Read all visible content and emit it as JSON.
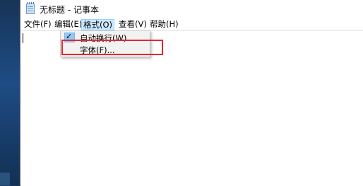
{
  "window": {
    "title": "无标题 - 记事本"
  },
  "menubar": {
    "items": [
      {
        "label": "文件(F)"
      },
      {
        "label": "编辑(E)"
      },
      {
        "label": "格式(O)"
      },
      {
        "label": "查看(V)"
      },
      {
        "label": "帮助(H)"
      }
    ]
  },
  "format_menu": {
    "word_wrap": {
      "label": "自动换行(W)",
      "checked": true
    },
    "font": {
      "label": "字体(F)..."
    }
  },
  "colors": {
    "highlight": "#e8262b",
    "menu_active": "#cce8ff"
  },
  "icons": {
    "app": "notepad-icon",
    "check": "checkmark-icon"
  }
}
